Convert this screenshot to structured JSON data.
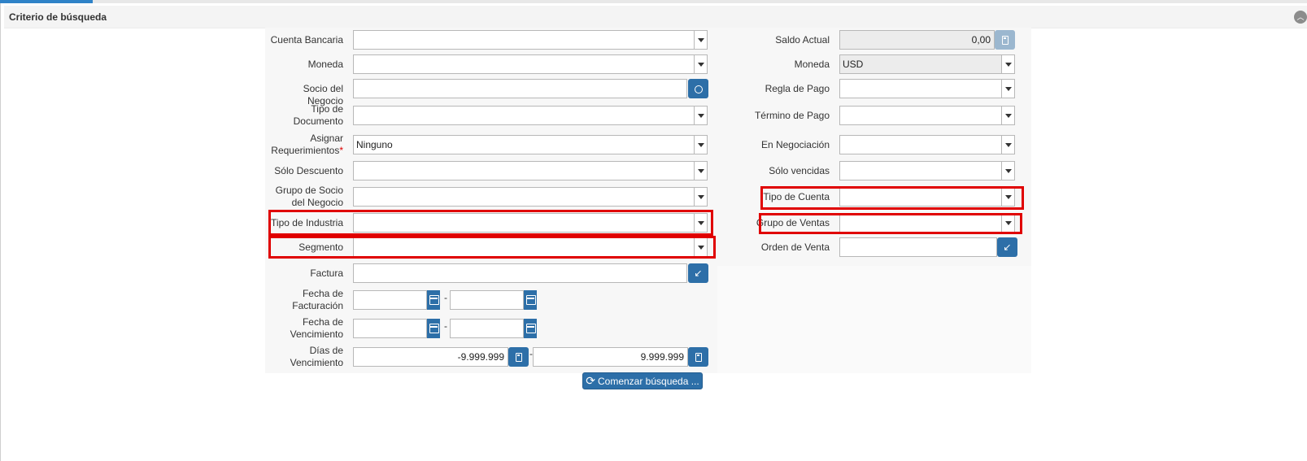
{
  "panel": {
    "title": "Criterio de búsqueda",
    "collapse_icon": "chevron-up-icon"
  },
  "left": {
    "cuenta_bancaria": {
      "label": "Cuenta Bancaria",
      "value": ""
    },
    "moneda": {
      "label": "Moneda",
      "value": ""
    },
    "socio_negocio": {
      "label": "Socio del Negocio",
      "value": ""
    },
    "tipo_documento": {
      "label_1": "Tipo de",
      "label_2": "Documento",
      "value": ""
    },
    "asignar_req": {
      "label_1": "Asignar",
      "label_2": "Requerimientos",
      "required": "*",
      "value": "Ninguno"
    },
    "solo_descuento": {
      "label": "Sólo Descuento",
      "value": ""
    },
    "grupo_socio": {
      "label_1": "Grupo de Socio",
      "label_2": "del Negocio",
      "value": ""
    },
    "tipo_industria": {
      "label": "Tipo de Industria",
      "value": ""
    },
    "segmento": {
      "label": "Segmento",
      "value": ""
    },
    "factura": {
      "label": "Factura",
      "value": ""
    },
    "fecha_facturacion": {
      "label_1": "Fecha de",
      "label_2": "Facturación",
      "from": "",
      "to": ""
    },
    "fecha_vencimiento": {
      "label_1": "Fecha de",
      "label_2": "Vencimiento",
      "from": "",
      "to": ""
    },
    "dias_vencimiento": {
      "label_1": "Días de",
      "label_2": "Vencimiento",
      "from": "-9.999.999",
      "to": "9.999.999"
    },
    "range_separator": "-"
  },
  "right": {
    "saldo_actual": {
      "label": "Saldo Actual",
      "value": "0,00"
    },
    "moneda": {
      "label": "Moneda",
      "value": "USD"
    },
    "regla_pago": {
      "label": "Regla de Pago",
      "value": ""
    },
    "termino_pago": {
      "label": "Término de Pago",
      "value": ""
    },
    "en_negociacion": {
      "label": "En Negociación",
      "value": ""
    },
    "solo_vencidas": {
      "label": "Sólo vencidas",
      "value": ""
    },
    "tipo_cuenta": {
      "label": "Tipo de Cuenta",
      "value": ""
    },
    "grupo_ventas": {
      "label": "Grupo de Ventas",
      "value": ""
    },
    "orden_venta": {
      "label": "Orden de Venta",
      "value": ""
    }
  },
  "actions": {
    "search_label": "Comenzar búsqueda ..."
  },
  "colors": {
    "accent": "#2d6fa8",
    "highlight": "#e00000"
  }
}
